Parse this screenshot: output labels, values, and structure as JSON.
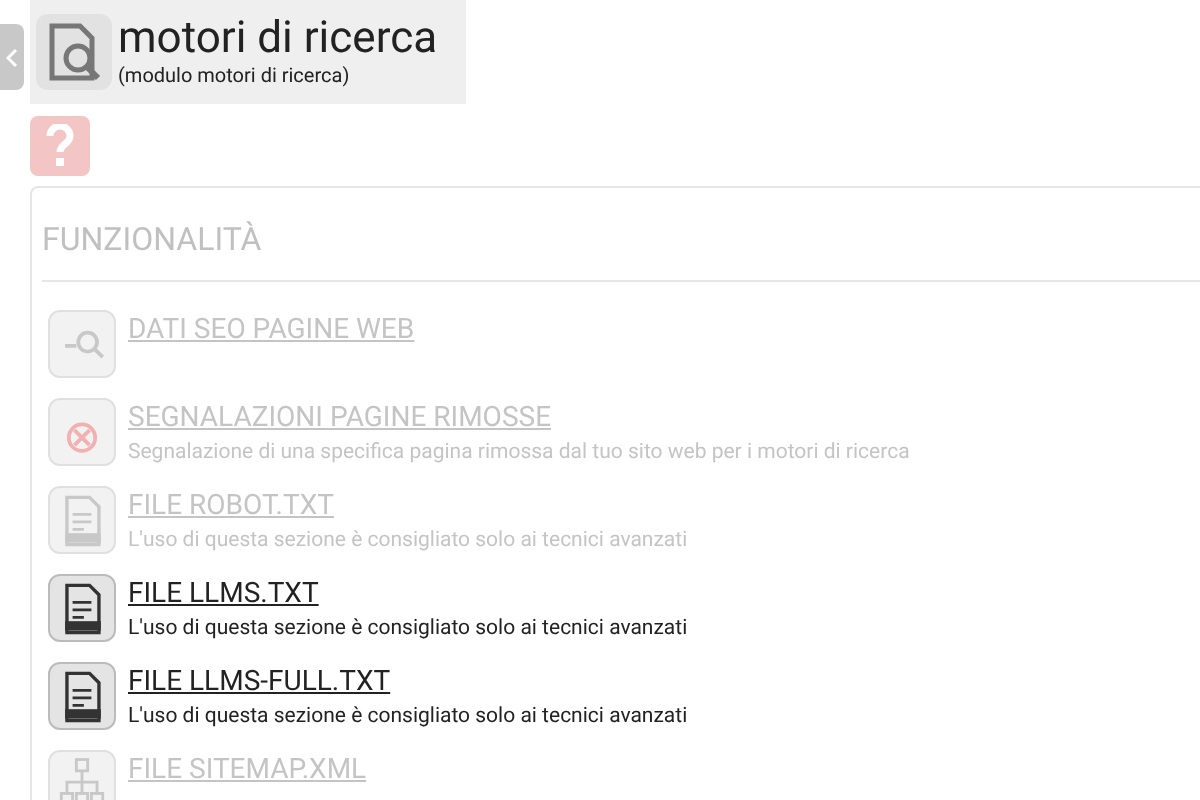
{
  "header": {
    "title": "motori di ricerca",
    "subtitle": "(modulo motori di ricerca)"
  },
  "section": {
    "title": "FUNZIONALITÀ"
  },
  "items": [
    {
      "kind": "seo",
      "title": "DATI SEO PAGINE WEB",
      "disabled": true
    },
    {
      "kind": "removed",
      "title": "SEGNALAZIONI PAGINE RIMOSSE",
      "description": "Segnalazione di una specifica pagina rimossa dal tuo sito web per i motori di ricerca",
      "disabled": true
    },
    {
      "kind": "file",
      "title": "FILE ROBOT.TXT",
      "description": "L'uso di questa sezione è consigliato solo ai tecnici avanzati",
      "disabled": true
    },
    {
      "kind": "file",
      "title": "FILE LLMS.TXT",
      "description": "L'uso di questa sezione è consigliato solo ai tecnici avanzati",
      "disabled": false
    },
    {
      "kind": "file",
      "title": "FILE LLMS-FULL.TXT",
      "description": "L'uso di questa sezione è consigliato solo ai tecnici avanzati",
      "disabled": false
    },
    {
      "kind": "sitemap",
      "title": "FILE SITEMAP.XML",
      "disabled": true
    }
  ]
}
